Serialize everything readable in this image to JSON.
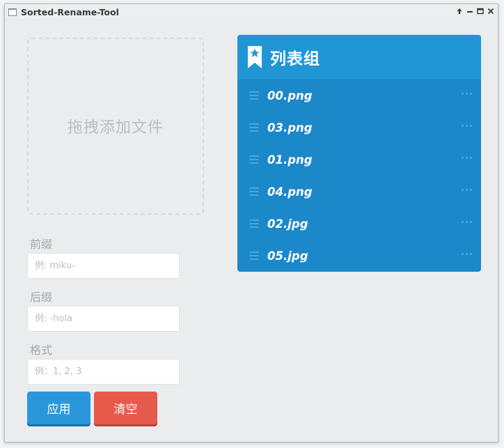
{
  "window": {
    "title": "Sorted-Rename-Tool",
    "controls": [
      "pin-icon",
      "minimize-icon",
      "maximize-icon",
      "close-icon"
    ]
  },
  "drop_zone": {
    "text": "拖拽添加文件"
  },
  "form": {
    "prefix": {
      "label": "前缀",
      "placeholder": "例: miku-",
      "value": ""
    },
    "suffix": {
      "label": "后缀",
      "placeholder": "例: -hola",
      "value": ""
    },
    "format": {
      "label": "格式",
      "placeholder": "例：1, 2, 3",
      "value": ""
    }
  },
  "buttons": {
    "apply": "应用",
    "clear": "清空"
  },
  "list_group": {
    "title": "列表组",
    "icon": "bookmark-star-icon",
    "items": [
      "00.png",
      "03.png",
      "01.png",
      "04.png",
      "02.jpg",
      "05.jpg"
    ]
  },
  "colors": {
    "list_header": "#2196d7",
    "list_body": "#1b88c9",
    "apply_button": "#2b97db",
    "clear_button": "#e65a4c"
  }
}
